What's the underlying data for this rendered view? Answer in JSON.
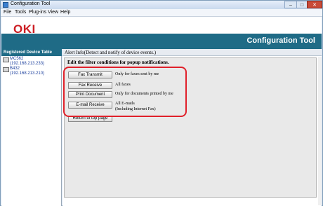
{
  "window": {
    "title": "Configuration Tool"
  },
  "menu": [
    "File",
    "Tools",
    "Plug-ins",
    "View",
    "Help"
  ],
  "banner": {
    "logo": "OKI",
    "title": "Configuration Tool"
  },
  "sidebar": {
    "header": "Registered Device Table",
    "devices": [
      {
        "name": "MC562",
        "ip": "(192.168.213.233)"
      },
      {
        "name": "B432",
        "ip": "(192.168.213.210)"
      }
    ]
  },
  "main": {
    "header": "Alert Info(Detect and notify of device events.)",
    "section_title": "Edit the filter conditions for popup notifications.",
    "filters": [
      {
        "button": "Fax Transmit",
        "desc": "Only for faxes sent by me"
      },
      {
        "button": "Fax Receive",
        "desc": "All faxes"
      },
      {
        "button": "Print Document",
        "desc": "Only for documents printed by me"
      },
      {
        "button": "E-mail Receive",
        "desc": "All E-mails",
        "desc2": "(Including Internet Fax)"
      }
    ],
    "return_button": "Return to top page"
  },
  "colors": {
    "brand_red": "#cc1d23",
    "banner_teal": "#1f6b86",
    "highlight_red": "#e0202a"
  }
}
